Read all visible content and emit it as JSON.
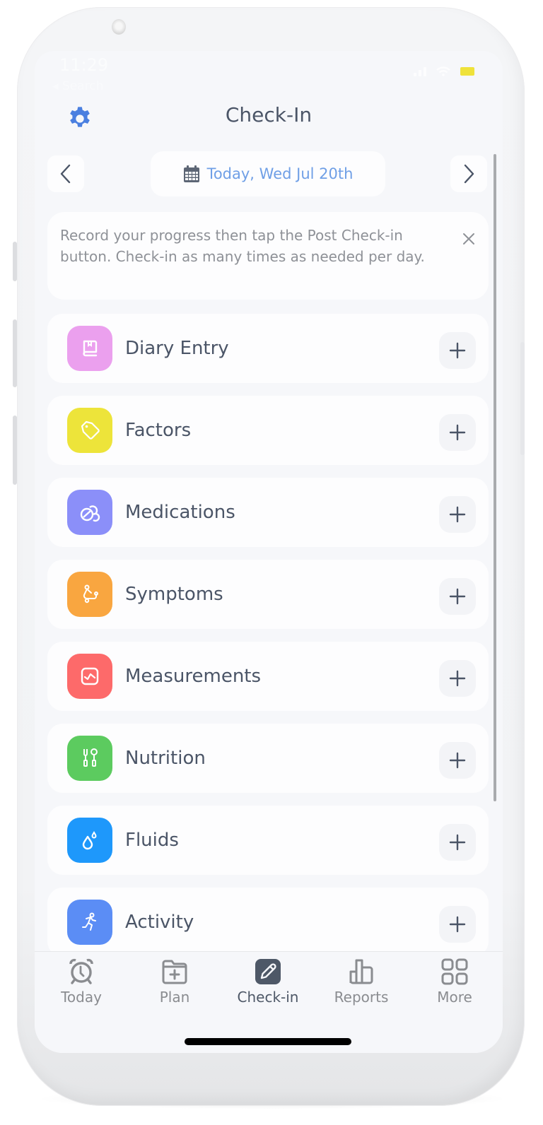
{
  "status_bar": {
    "time": "11:29",
    "back_label": "◂ Search"
  },
  "header": {
    "title": "Check-In",
    "settings_icon": "gear-icon"
  },
  "date_nav": {
    "prev_icon": "chevron-left-icon",
    "next_icon": "chevron-right-icon",
    "date_label": "Today, Wed Jul 20th",
    "calendar_icon": "calendar-icon"
  },
  "info_card": {
    "text": "Record your progress then tap the Post Check-in button. Check-in as many times as needed per day.",
    "close_icon": "close-icon"
  },
  "categories": [
    {
      "label": "Diary Entry",
      "icon": "book-icon",
      "color": "#eba0ee"
    },
    {
      "label": "Factors",
      "icon": "tag-icon",
      "color": "#ede43a"
    },
    {
      "label": "Medications",
      "icon": "pills-icon",
      "color": "#8b8ff9"
    },
    {
      "label": "Symptoms",
      "icon": "stethoscope-icon",
      "color": "#f9a640"
    },
    {
      "label": "Measurements",
      "icon": "chart-monitor-icon",
      "color": "#fd6a6a"
    },
    {
      "label": "Nutrition",
      "icon": "utensils-icon",
      "color": "#5ccb5f"
    },
    {
      "label": "Fluids",
      "icon": "droplet-icon",
      "color": "#1e98fb"
    },
    {
      "label": "Activity",
      "icon": "running-icon",
      "color": "#5b8df5"
    }
  ],
  "add_icon": "plus-icon",
  "tabs": [
    {
      "label": "Today",
      "icon": "alarm-clock-icon",
      "active": false
    },
    {
      "label": "Plan",
      "icon": "folder-plus-icon",
      "active": false
    },
    {
      "label": "Check-in",
      "icon": "edit-icon",
      "active": true
    },
    {
      "label": "Reports",
      "icon": "bar-chart-icon",
      "active": false
    },
    {
      "label": "More",
      "icon": "grid-icon",
      "active": false
    }
  ],
  "colors": {
    "accent_blue": "#4a7fe0",
    "date_text": "#6f9fe6",
    "text_primary": "#4b5567",
    "text_muted": "#8e9197",
    "battery": "#efe23a"
  }
}
